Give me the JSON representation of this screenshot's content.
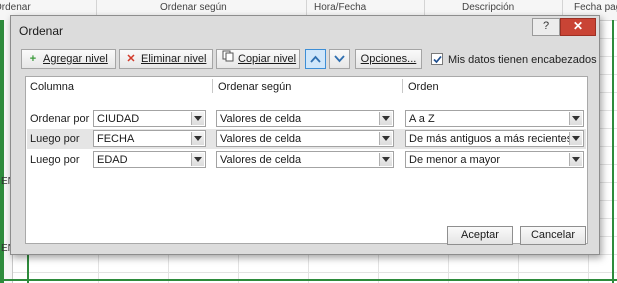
{
  "sheet": {
    "headers": [
      "Ordenar",
      "Ordenar según",
      "Hora/Fecha",
      "Descripción",
      "Fecha pago"
    ],
    "row_fragments": [
      "EN",
      "EN"
    ]
  },
  "dialog": {
    "title": "Ordenar",
    "help_label": "?",
    "close_label": "✕",
    "toolbar": {
      "add_level": "Agregar nivel",
      "delete_level": "Eliminar nivel",
      "copy_level": "Copiar nivel",
      "options": "Opciones...",
      "has_headers_label": "Mis datos tienen encabezados",
      "has_headers_checked": true
    },
    "columns": {
      "column": "Columna",
      "sort_on": "Ordenar según",
      "order": "Orden"
    },
    "levels": [
      {
        "label": "Ordenar por",
        "column": "CIUDAD",
        "sort_on": "Valores de celda",
        "order": "A a Z",
        "selected": false
      },
      {
        "label": "Luego por",
        "column": "FECHA",
        "sort_on": "Valores de celda",
        "order": "De más antiguos a más recientes",
        "selected": true
      },
      {
        "label": "Luego por",
        "column": "EDAD",
        "sort_on": "Valores de celda",
        "order": "De menor a mayor",
        "selected": false
      }
    ],
    "buttons": {
      "accept": "Aceptar",
      "cancel": "Cancelar"
    }
  },
  "colors": {
    "accent_green": "#2e8b3c",
    "close_red": "#c94435",
    "active_blue": "#3d8ed6"
  }
}
